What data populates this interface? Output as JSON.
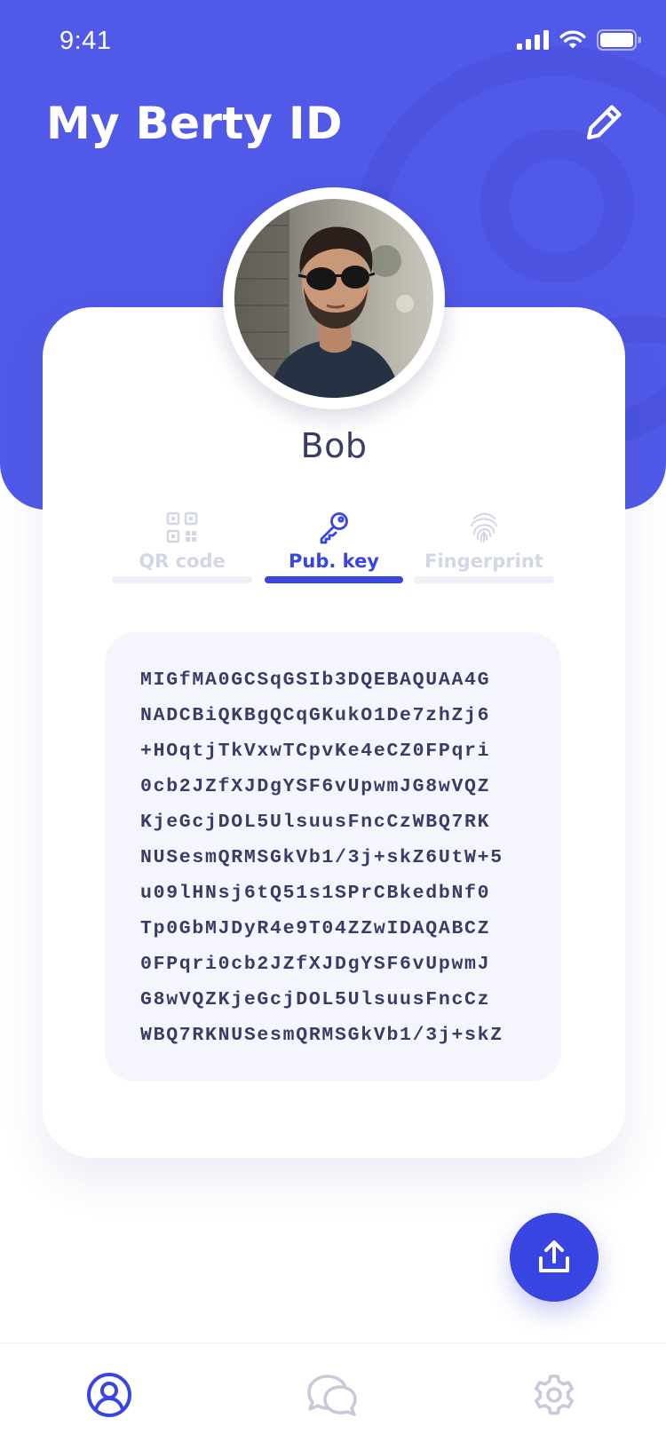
{
  "status_bar": {
    "time": "9:41",
    "icons": [
      "cellular-signal-icon",
      "wifi-icon",
      "battery-icon"
    ]
  },
  "header": {
    "title": "My Berty ID",
    "edit_icon": "pencil-icon"
  },
  "profile": {
    "name": "Bob",
    "avatar": "profile-photo"
  },
  "tabs": [
    {
      "label": "QR code",
      "icon": "qr-code-icon",
      "active": false
    },
    {
      "label": "Pub. key",
      "icon": "key-icon",
      "active": true
    },
    {
      "label": "Fingerprint",
      "icon": "fingerprint-icon",
      "active": false
    }
  ],
  "public_key": {
    "lines": [
      "MIGfMA0GCSqGSIb3DQEBAQUAA4G",
      "NADCBiQKBgQCqGKukO1De7zhZj6",
      "+HOqtjTkVxwTCpvKe4eCZ0FPqri",
      "0cb2JZfXJDgYSF6vUpwmJG8wVQZ",
      "KjeGcjDOL5UlsuusFncCzWBQ7RK",
      "NUSesmQRMSGkVb1/3j+skZ6UtW+5",
      "u09lHNsj6tQ51s1SPrCBkedbNf0",
      "Tp0GbMJDyR4e9T04ZZwIDAQABCZ",
      "0FPqri0cb2JZfXJDgYSF6vUpwmJ",
      "G8wVQZKjeGcjDOL5UlsuusFncCz",
      "WBQ7RKNUSesmQRMSGkVb1/3j+skZ"
    ]
  },
  "share_button": {
    "icon": "share-upload-icon"
  },
  "bottom_nav": [
    {
      "icon": "profile-icon",
      "active": true
    },
    {
      "icon": "chat-bubbles-icon",
      "active": false
    },
    {
      "icon": "settings-gear-icon",
      "active": false
    }
  ],
  "colors": {
    "primary": "#3845e0",
    "header_bg": "#5159e8",
    "text_dark": "#393c63",
    "inactive": "#d3d6e4",
    "key_box_bg": "#f5f6fd"
  }
}
